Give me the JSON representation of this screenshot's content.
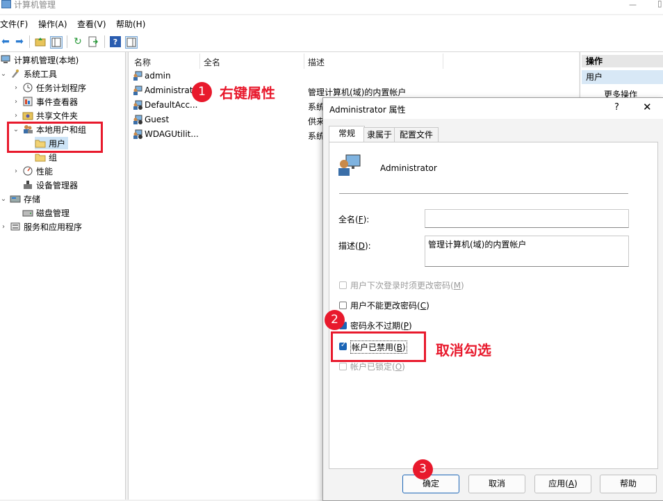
{
  "window": {
    "title": "计算机管理"
  },
  "menubar": {
    "items": [
      "文件(F)",
      "操作(A)",
      "查看(V)",
      "帮助(H)"
    ]
  },
  "tree": {
    "root": "计算机管理(本地)",
    "system_tools": "系统工具",
    "task_scheduler": "任务计划程序",
    "event_viewer": "事件查看器",
    "shared_folders": "共享文件夹",
    "local_users_groups": "本地用户和组",
    "users": "用户",
    "groups": "组",
    "performance": "性能",
    "device_manager": "设备管理器",
    "storage": "存储",
    "disk_management": "磁盘管理",
    "services_apps": "服务和应用程序"
  },
  "list": {
    "columns": [
      "名称",
      "全名",
      "描述"
    ],
    "rows": [
      {
        "name": "admin",
        "desc": ""
      },
      {
        "name": "Administrat",
        "desc": "管理计算机(域)的内置帐户"
      },
      {
        "name": "DefaultAcc...",
        "desc": "系统"
      },
      {
        "name": "Guest",
        "desc": "供来"
      },
      {
        "name": "WDAGUtilit...",
        "desc": "系统"
      }
    ]
  },
  "actions": {
    "header": "操作",
    "section": "用户",
    "more": "更多操作"
  },
  "dialog": {
    "title": "Administrator 属性",
    "help_glyph": "?",
    "close_glyph": "✕",
    "tabs": [
      "常规",
      "隶属于",
      "配置文件"
    ],
    "username": "Administrator",
    "fullname_label": "全名(",
    "fullname_key": "F",
    "fullname_suffix": "):",
    "fullname_value": "",
    "desc_label": "描述(",
    "desc_key": "D",
    "desc_suffix": "):",
    "desc_value": "管理计算机(域)的内置帐户",
    "chk_must_change": {
      "label": "用户下次登录时须更改密码(",
      "key": "M",
      "suffix": ")",
      "checked": false,
      "disabled": true
    },
    "chk_cannot_change": {
      "label": "用户不能更改密码(",
      "key": "C",
      "suffix": ")",
      "checked": false,
      "disabled": false
    },
    "chk_never_expires": {
      "label": "密码永不过期(",
      "key": "P",
      "suffix": ")",
      "checked": true,
      "disabled": false
    },
    "chk_disabled": {
      "label": "帐户已禁用(",
      "key": "B",
      "suffix": ")",
      "checked": true,
      "disabled": false
    },
    "chk_locked": {
      "label": "帐户已锁定(",
      "key": "O",
      "suffix": ")",
      "checked": false,
      "disabled": true
    },
    "buttons": {
      "ok": "确定",
      "cancel": "取消",
      "apply_prefix": "应用(",
      "apply_key": "A",
      "apply_suffix": ")",
      "help": "帮助"
    }
  },
  "annotations": {
    "step1": "1",
    "step1_text": "右键属性",
    "step2": "2",
    "step2_text": "取消勾选",
    "step3": "3"
  },
  "colors": {
    "annotation_red": "#e8192c",
    "accent_blue": "#1a64b6",
    "selection": "#cce3f6"
  }
}
